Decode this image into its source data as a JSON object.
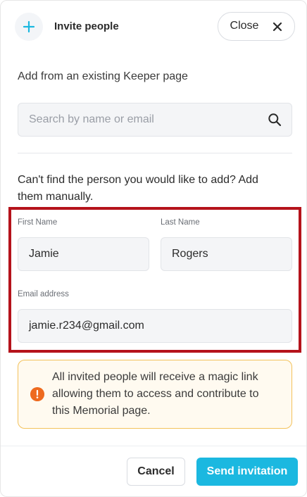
{
  "header": {
    "title": "Invite people",
    "close_label": "Close"
  },
  "search": {
    "section_label": "Add from an existing Keeper page",
    "placeholder": "Search by name or email"
  },
  "manual": {
    "prompt": "Can't find the person you would like to add? Add them manually.",
    "first_name": {
      "label": "First Name",
      "value": "Jamie"
    },
    "last_name": {
      "label": "Last Name",
      "value": "Rogers"
    },
    "email": {
      "label": "Email address",
      "value": "jamie.r234@gmail.com"
    }
  },
  "notice": {
    "text": "All invited people will receive a magic link allowing them to access and contribute to this Memorial page."
  },
  "footer": {
    "cancel_label": "Cancel",
    "send_label": "Send invitation"
  },
  "colors": {
    "accent": "#1bb8e0",
    "highlight": "#b5131b",
    "notice_border": "#f3c25b",
    "notice_icon": "#ee6a1f"
  }
}
